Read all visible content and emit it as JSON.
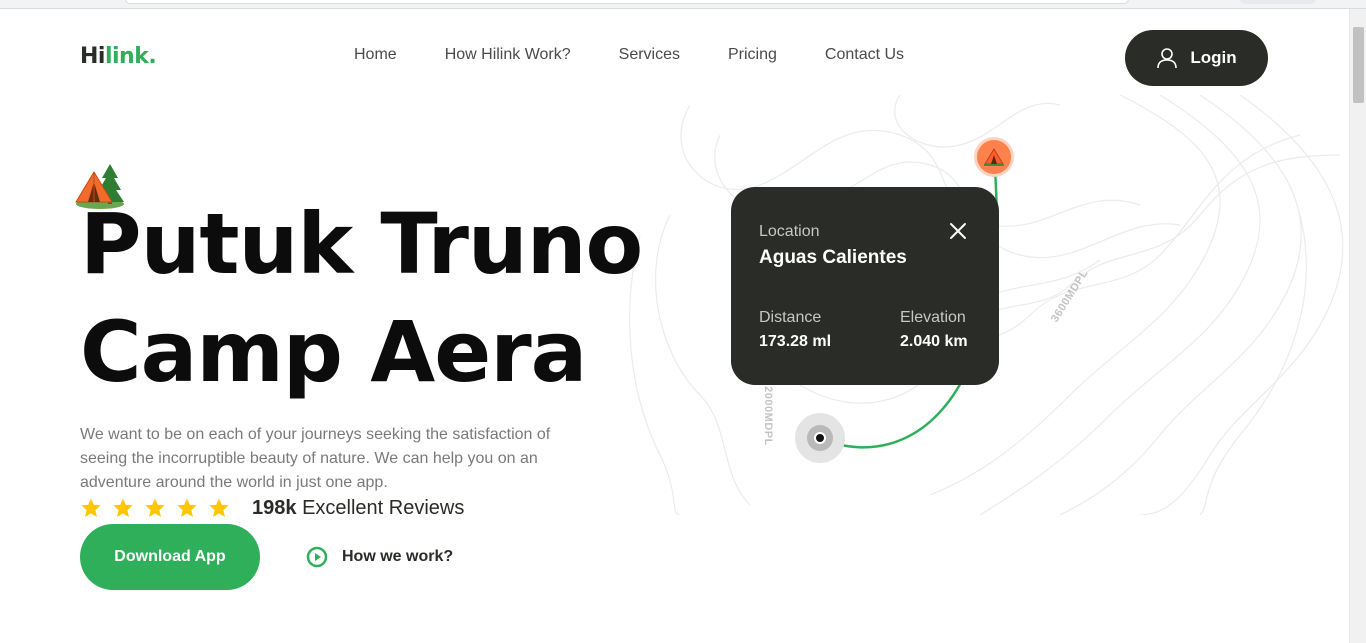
{
  "brand": {
    "logo_dark": "Hi",
    "logo_green": "link."
  },
  "nav": {
    "items": [
      {
        "label": "Home"
      },
      {
        "label": "How Hilink Work?"
      },
      {
        "label": "Services"
      },
      {
        "label": "Pricing"
      },
      {
        "label": "Contact Us"
      }
    ],
    "login_label": "Login"
  },
  "hero": {
    "title_line1": "Putuk Truno",
    "title_line2": "Camp Aera",
    "description": "We want to be on each of your journeys seeking the satisfaction of seeing the incorruptible beauty of nature. We can help you on an adventure around the world in just one app.",
    "rating": 5,
    "reviews_count": "198k",
    "reviews_label": "Excellent Reviews",
    "download_label": "Download App",
    "how_label": "How we work?"
  },
  "map": {
    "card": {
      "location_label": "Location",
      "location_name": "Aguas Calientes",
      "distance_label": "Distance",
      "distance_value": "173.28 ml",
      "elevation_label": "Elevation",
      "elevation_value": "2.040 km"
    },
    "contour_label_1": "3600MDPL",
    "contour_label_2": "2000MDPL"
  },
  "colors": {
    "accent": "#30af5b",
    "dark": "#292c27",
    "pin": "#ff814c",
    "star": "#fec601"
  },
  "icons": [
    "camp-tent-icon",
    "user-icon",
    "star-icon",
    "close-icon",
    "play-icon",
    "map-pin-icon"
  ]
}
